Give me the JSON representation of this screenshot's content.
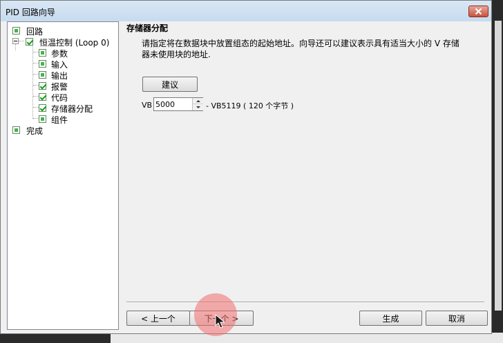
{
  "window": {
    "title": "PID 回路向导"
  },
  "tree": {
    "items": [
      {
        "label": "回路",
        "checked": false
      },
      {
        "label": "恒温控制 (Loop 0)",
        "checked": true
      },
      {
        "label": "参数",
        "checked": false
      },
      {
        "label": "输入",
        "checked": false
      },
      {
        "label": "输出",
        "checked": false
      },
      {
        "label": "报警",
        "checked": true
      },
      {
        "label": "代码",
        "checked": true
      },
      {
        "label": "存储器分配",
        "checked": true
      },
      {
        "label": "组件",
        "checked": false
      },
      {
        "label": "完成",
        "checked": false
      }
    ]
  },
  "page": {
    "title": "存储器分配",
    "description": "请指定将在数据块中放置组态的起始地址。向导还可以建议表示具有适当大小的 V 存储器未使用块的地址.",
    "suggest_label": "建议",
    "vb_prefix": "VB",
    "vb_value": "5000",
    "range_text": "- VB5119 ( 120 个字节 )"
  },
  "buttons": {
    "prev": "< 上一个",
    "next": "下一个 >",
    "generate": "生成",
    "cancel": "取消"
  },
  "colors": {
    "titlebar": "#c7dbef",
    "close": "#c8533c",
    "check": "#179e17",
    "cursor_halo": "#f06e6e"
  }
}
